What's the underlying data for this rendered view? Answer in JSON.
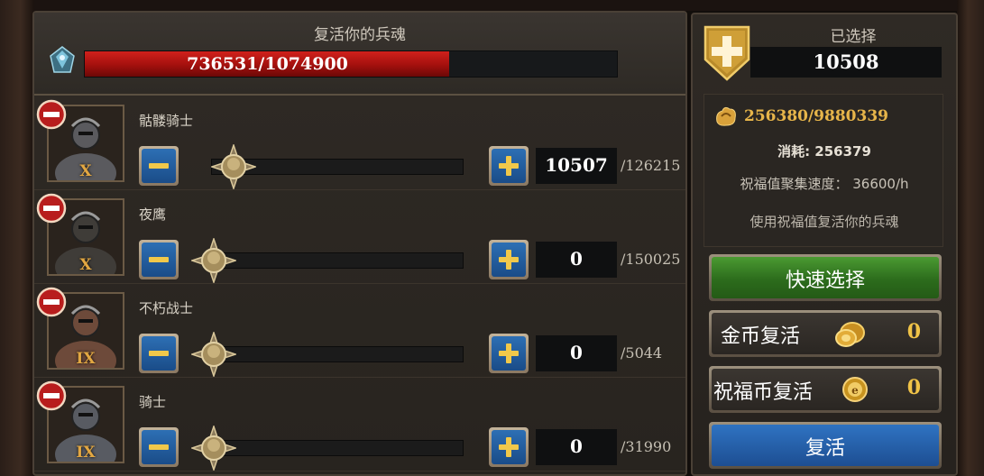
{
  "header": {
    "title": "复活你的兵魂",
    "soul_progress_text": "736531/1074900",
    "soul_current": 736531,
    "soul_max": 1074900
  },
  "troops": [
    {
      "name": "骷髅骑士",
      "rank": "X",
      "count": "10507",
      "max": "/126215",
      "slider_fraction": 0.08
    },
    {
      "name": "夜鹰",
      "rank": "X",
      "count": "0",
      "max": "/150025",
      "slider_fraction": 0.0
    },
    {
      "name": "不朽战士",
      "rank": "IX",
      "count": "0",
      "max": "/5044",
      "slider_fraction": 0.0
    },
    {
      "name": "骑士",
      "rank": "IX",
      "count": "0",
      "max": "/31990",
      "slider_fraction": 0.0
    }
  ],
  "side": {
    "selected_label": "已选择",
    "selected_value": "10508",
    "bless_value": "256380/9880339",
    "consume_text": "消耗: 256379",
    "speed_text": "祝福值聚集速度： 36600/h",
    "hint_text": "使用祝福值复活你的兵魂",
    "quick_select_label": "快速选择",
    "gold_revive_label": "金币复活",
    "gold_revive_count": "0",
    "bless_coin_revive_label": "祝福币复活",
    "bless_coin_revive_count": "0",
    "revive_label": "复活"
  },
  "icons": [
    "soul-crystal-icon",
    "remove-icon",
    "minus-icon",
    "plus-icon",
    "slider-knob-icon",
    "add-shield-icon",
    "bless-icon",
    "gold-coin-icon",
    "bless-coin-icon"
  ],
  "colors": {
    "progress_red": "#c41a16",
    "button_blue": "#2d6fb4",
    "quick_green": "#3c8a28",
    "gold_text": "#f0c347"
  }
}
